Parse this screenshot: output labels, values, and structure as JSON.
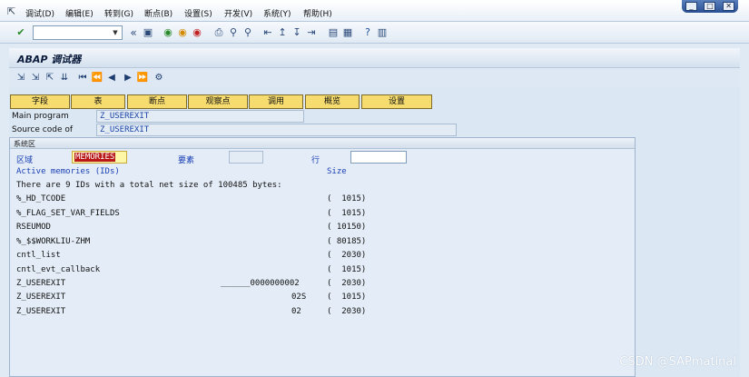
{
  "menu": {
    "items": [
      "调试(D)",
      "编辑(E)",
      "转到(G)",
      "断点(B)",
      "设置(S)",
      "开发(V)",
      "系统(Y)",
      "帮助(H)"
    ],
    "window_controls": [
      "_",
      "□",
      "✕"
    ]
  },
  "toolbar": {
    "command_value": "",
    "icons": [
      "check-icon",
      "save-icon",
      "back-icon",
      "exit-icon",
      "cancel-icon",
      "print-icon",
      "find-icon",
      "find-next-icon",
      "first-page-icon",
      "prev-page-icon",
      "next-page-icon",
      "last-page-icon",
      "new-session-icon",
      "shortcut-icon",
      "help-icon",
      "layout-icon"
    ]
  },
  "title": "ABAP 调试器",
  "app_toolbar": {
    "icons": [
      "single-step-icon",
      "execute-icon",
      "return-icon",
      "continue-icon",
      "first-icon",
      "prev-icon",
      "next-icon",
      "last-icon",
      "settings-icon"
    ]
  },
  "tabs": [
    "字段",
    "表",
    "断点",
    "观察点",
    "调用",
    "概览",
    "设置"
  ],
  "main_program": {
    "label": "Main program",
    "value": "Z_USEREXIT"
  },
  "source_code": {
    "label": "Source code of",
    "value": "Z_USEREXIT"
  },
  "system_area": {
    "title": "系统区",
    "area_label": "区域",
    "area_value": "MEMORIES",
    "element_label": "要素",
    "element_value": "",
    "row_label": "行",
    "row_value": "",
    "header_left": "Active memories (IDs)",
    "header_right": "Size",
    "summary": "There are 9 IDs with a total net size of 100485 bytes:",
    "rows": [
      {
        "id": "%_HD_TCODE",
        "mid": "",
        "size": "(  1015)"
      },
      {
        "id": "%_FLAG_SET_VAR_FIELDS",
        "mid": "",
        "size": "(  1015)"
      },
      {
        "id": "RSEUMOD",
        "mid": "",
        "size": "( 10150)"
      },
      {
        "id": "%_$$WORKLIU-ZHM",
        "mid": "",
        "size": "( 80185)"
      },
      {
        "id": "cntl_list",
        "mid": "",
        "size": "(  2030)"
      },
      {
        "id": "cntl_evt_callback",
        "mid": "",
        "size": "(  1015)"
      },
      {
        "id": "Z_USEREXIT",
        "mid": "______0000000002",
        "size": "(  2030)"
      },
      {
        "id": "Z_USEREXIT",
        "mid": "02S",
        "size": "(  1015)"
      },
      {
        "id": "Z_USEREXIT",
        "mid": "02",
        "size": "(  2030)"
      }
    ]
  },
  "watermark": "CSDN @SAPmatinal"
}
